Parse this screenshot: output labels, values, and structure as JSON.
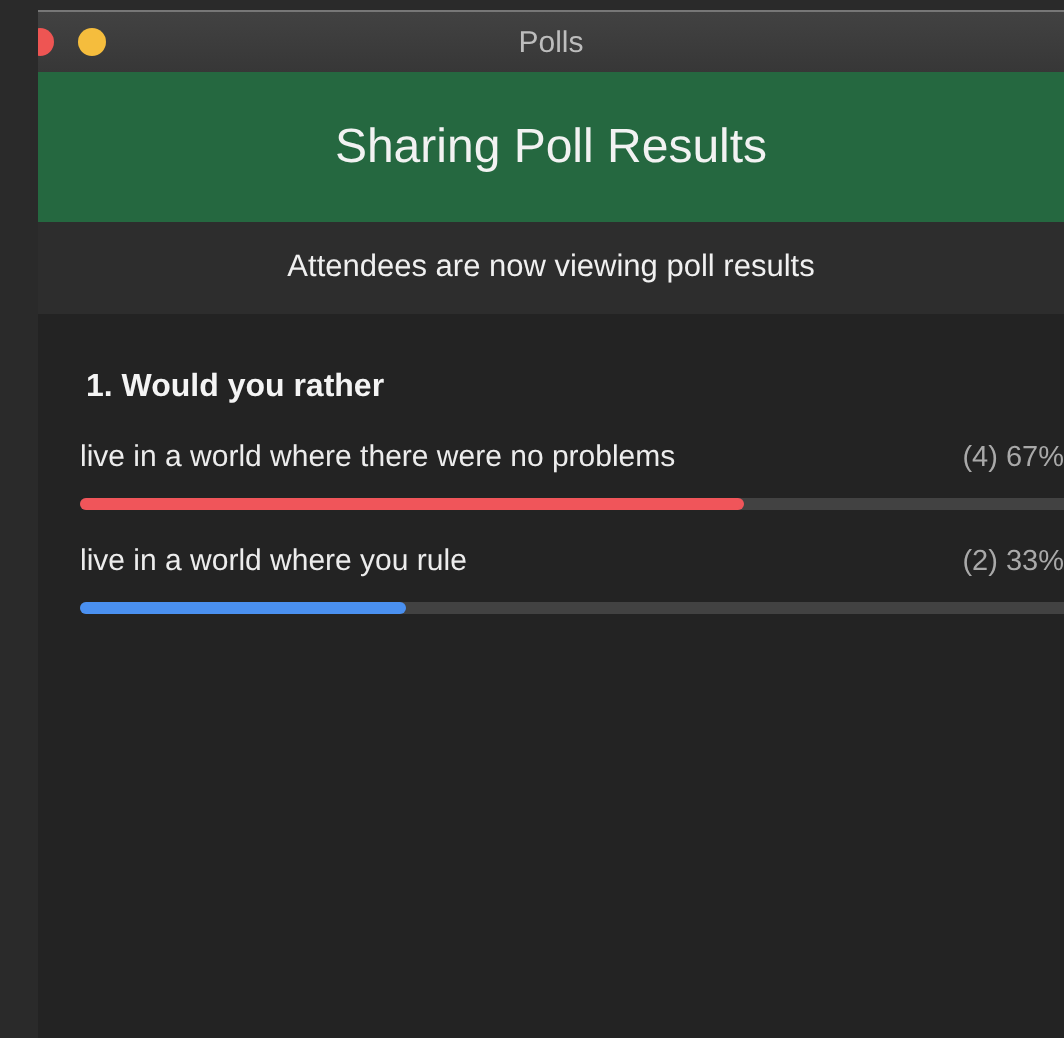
{
  "window": {
    "title": "Polls"
  },
  "header": {
    "title": "Sharing Poll Results"
  },
  "banner": {
    "text": "Attendees are now viewing poll results"
  },
  "question": {
    "title": "1. Would you rather",
    "options": [
      {
        "label": "live in a world where there were no problems",
        "reading": "(4) 67%",
        "level": 0.67,
        "color": "#f0555a"
      },
      {
        "label": "live in a world where you rule",
        "reading": "(2) 33%",
        "level": 0.33,
        "color": "#4a90f0"
      }
    ]
  }
}
